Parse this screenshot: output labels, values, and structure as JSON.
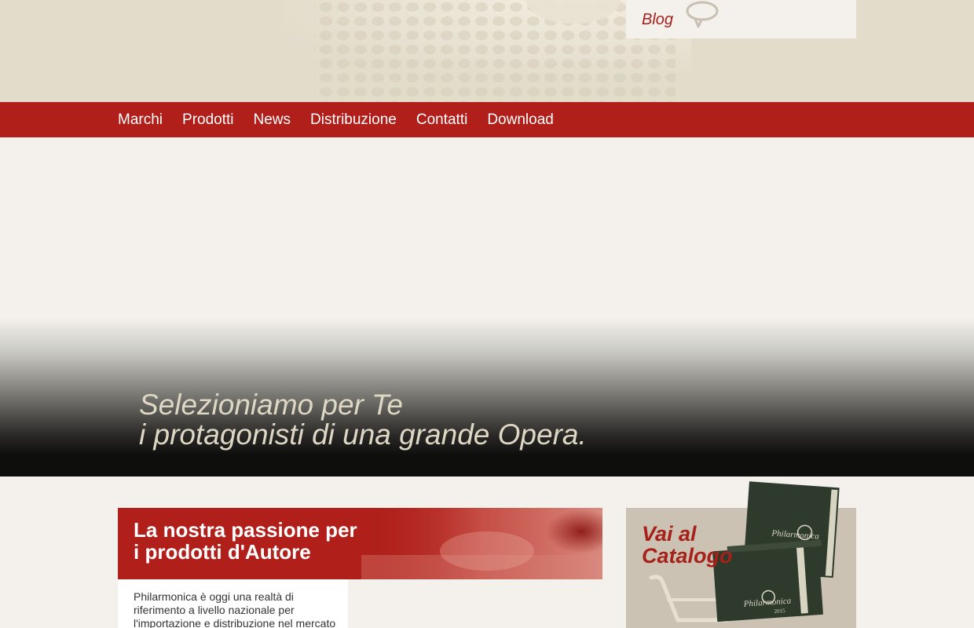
{
  "header": {
    "blog_label": "Blog",
    "icons": {
      "blog": "speech-bubble-icon"
    }
  },
  "nav": {
    "items": [
      {
        "label": "Marchi"
      },
      {
        "label": "Prodotti"
      },
      {
        "label": "News"
      },
      {
        "label": "Distribuzione"
      },
      {
        "label": "Contatti"
      },
      {
        "label": "Download"
      }
    ]
  },
  "hero": {
    "line1": "Selezioniamo per Te",
    "line2": "i protagonisti di una grande Opera."
  },
  "passion": {
    "title_line1": "La nostra passione per",
    "title_line2": "i prodotti d'Autore"
  },
  "intro": {
    "text": "Philarmonica è oggi una realtà di riferimento a livello nazionale per l'importazione e distribuzione nel mercato"
  },
  "catalog": {
    "title_line1": "Vai al",
    "title_line2": "Catalogo",
    "book_brand": "Philarmonica",
    "book_year": "2015",
    "icons": {
      "cart": "shopping-cart-icon"
    }
  },
  "colors": {
    "accent_red": "#b01f1a",
    "header_beige": "#e2dccb",
    "page_background": "#f4f1ec",
    "catalog_background": "#cbc2b3",
    "hero_text": "#ddd7c4",
    "book_green": "#2e3a2c"
  }
}
